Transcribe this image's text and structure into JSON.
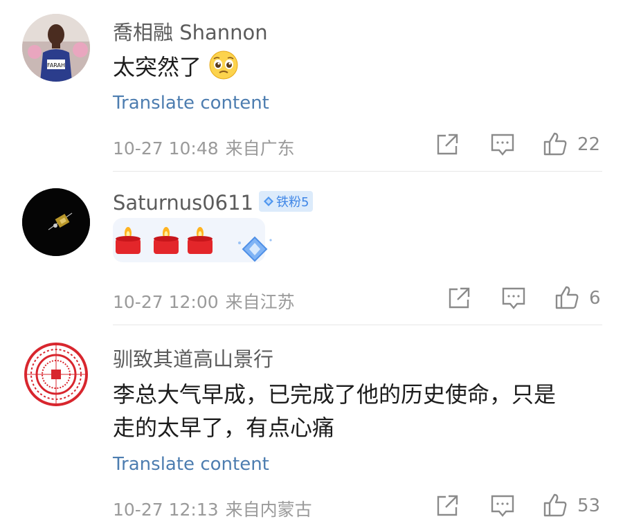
{
  "comments": [
    {
      "username": "喬相融 Shannon",
      "text_line1": "太突然了",
      "translate": "Translate content",
      "date": "10-27 10:48",
      "location": "来自广东",
      "likes": "22",
      "avatar_jersey": "FARAH"
    },
    {
      "username": "Saturnus0611",
      "badge": "铁粉5",
      "date": "10-27 12:00",
      "location": "来自江苏",
      "likes": "6"
    },
    {
      "username": "驯致其道高山景行",
      "text_line1": "李总大气早成，已完成了他的历史使命，只是",
      "text_line2": "走的太早了，有点心痛",
      "translate": "Translate content",
      "date": "10-27 12:13",
      "location": "来自内蒙古",
      "likes": "53"
    }
  ],
  "icons": {
    "repost": "share-square-icon",
    "comment": "comment-bubble-icon",
    "like": "thumbs-up-icon",
    "emoji_pleading": "pleading-face-emoji",
    "candle": "candle-emoji",
    "badge": "diamond-icon"
  },
  "colors": {
    "link": "#4d7db0",
    "badge_bg": "#dcebfb",
    "badge_text": "#3f86e6"
  }
}
